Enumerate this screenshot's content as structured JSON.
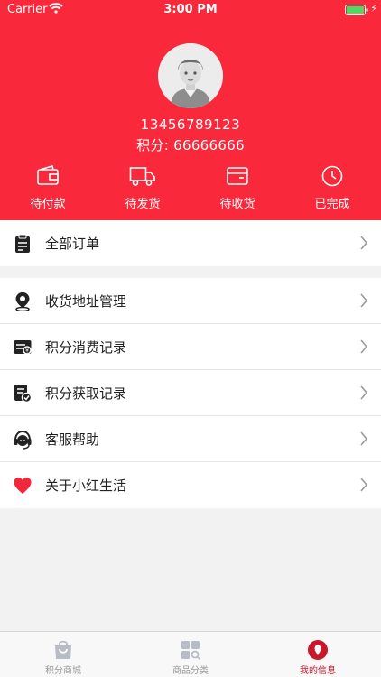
{
  "status_bar": {
    "carrier": "Carrier",
    "time": "3:00 PM"
  },
  "profile": {
    "phone": "13456789123",
    "points": "积分: 66666666"
  },
  "orders": [
    {
      "label": "待付款"
    },
    {
      "label": "待发货"
    },
    {
      "label": "待收货"
    },
    {
      "label": "已完成"
    }
  ],
  "menu": {
    "all_orders": "全部订单",
    "items": [
      {
        "label": "收货地址管理"
      },
      {
        "label": "积分消费记录"
      },
      {
        "label": "积分获取记录"
      },
      {
        "label": "客服帮助"
      },
      {
        "label": "关于小红生活"
      }
    ]
  },
  "tabbar": [
    {
      "label": "积分商城"
    },
    {
      "label": "商品分类"
    },
    {
      "label": "我的信息"
    }
  ],
  "colors": {
    "brand": "#f9283a",
    "tab_active": "#c8192c",
    "heart": "#f0283a"
  }
}
